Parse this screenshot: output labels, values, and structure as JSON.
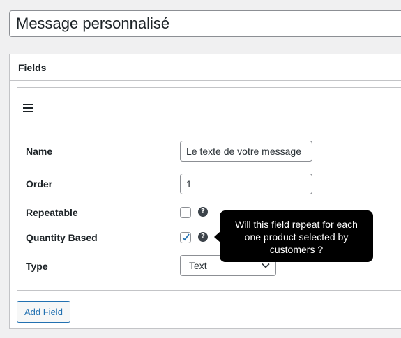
{
  "title_input": {
    "value": "Message personnalisé"
  },
  "fields_box": {
    "heading": "Fields"
  },
  "field": {
    "drag_icon": "hamburger-menu-icon",
    "rows": {
      "name_label": "Name",
      "name_value": "Le texte de votre message",
      "order_label": "Order",
      "order_value": "1",
      "repeatable_label": "Repeatable",
      "repeatable_checked": false,
      "quantity_based_label": "Quantity Based",
      "quantity_based_checked": true,
      "type_label": "Type",
      "type_value": "Text"
    },
    "help_icon": "question-circle-icon"
  },
  "tooltip": {
    "text": "Will this field repeat for each one product selected by customers ?"
  },
  "add_field_button": {
    "label": "Add Field"
  },
  "colors": {
    "accent": "#2271b1",
    "tooltip_bg": "#000000",
    "background": "#f0f0f1",
    "checkmark": "#2271b1"
  }
}
